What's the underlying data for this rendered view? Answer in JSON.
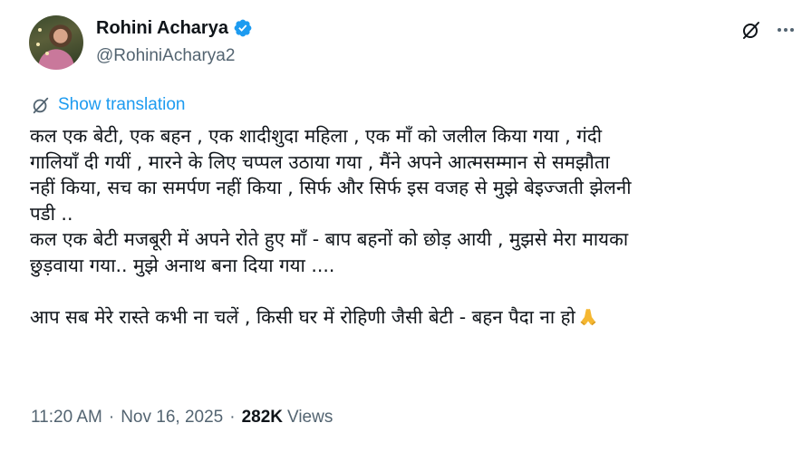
{
  "author": {
    "name": "Rohini Acharya",
    "handle": "@RohiniAcharya2",
    "verified": true
  },
  "header_icons": [
    "grok-icon",
    "more-options-icon"
  ],
  "translate": {
    "label": "Show translation",
    "icon": "translate-icon"
  },
  "tweet": {
    "lines": [
      "कल एक बेटी, एक बहन , एक शादीशुदा महिला , एक माँ को जलील किया गया , गंदी",
      "गालियाँ दी गयीं , मारने के लिए चप्पल उठाया गया , मैंने  अपने आत्मसम्मान से समझौता",
      "नहीं किया, सच का समर्पण नहीं किया , सिर्फ और सिर्फ इस वजह से मुझे बेइज्जती झेलनी",
      "पडी ..",
      "कल एक बेटी मजबूरी में अपने रोते हुए माँ - बाप बहनों को छोड़  आयी , मुझसे मेरा मायका",
      "छुड़वाया गया.. मुझे अनाथ बना दिया गया ....",
      "",
      "आप सब मेरे रास्ते कभी ना चलें , किसी घर में रोहिणी जैसी बेटी - बहन  पैदा ना  हो"
    ],
    "emoji": "folded-hands-icon"
  },
  "meta": {
    "time": "11:20 AM",
    "date": "Nov 16, 2025",
    "separator": "·",
    "views_count": "282K",
    "views_label": "Views"
  },
  "colors": {
    "text": "#0f1419",
    "muted": "#536471",
    "accent": "#1d9bf0",
    "emoji": "#f5b731"
  }
}
